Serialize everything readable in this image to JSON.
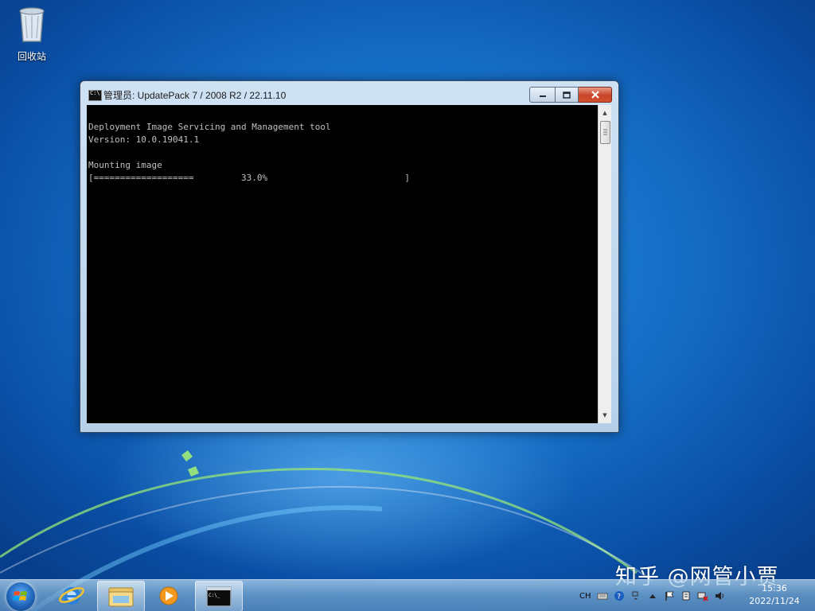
{
  "desktop": {
    "recycle_bin_label": "回收站",
    "watermark": "知乎 @网管小贾"
  },
  "window": {
    "title": "管理员:  UpdatePack 7 / 2008 R2 / 22.11.10",
    "icon_text": "C:\\",
    "console_lines": [
      "Deployment Image Servicing and Management tool",
      "Version: 10.0.19041.1",
      "",
      "Mounting image",
      "[===================         33.0%                          ]"
    ],
    "progress_percent": 33.0
  },
  "taskbar": {
    "items": [
      {
        "name": "internet-explorer",
        "icon": "ie-icon"
      },
      {
        "name": "windows-explorer",
        "icon": "folder-icon"
      },
      {
        "name": "media-player",
        "icon": "media-player-icon"
      },
      {
        "name": "command-prompt",
        "icon": "cmd-icon",
        "active": true
      }
    ],
    "tray": {
      "language": "CH",
      "time": "15:36",
      "date": "2022/11/24"
    }
  },
  "colors": {
    "desktop_blue": "#1670c8",
    "console_bg": "#000000",
    "console_text": "#c0c0c0",
    "close_red": "#c74528"
  }
}
